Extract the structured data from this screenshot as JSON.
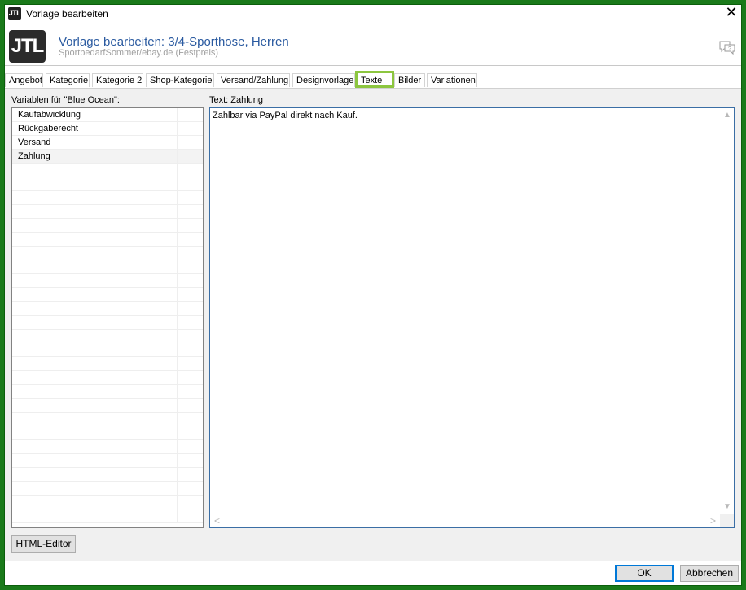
{
  "window": {
    "icon_text": "JTL",
    "title": "Vorlage bearbeiten",
    "close_glyph": "✕"
  },
  "header": {
    "logo_text": "JTL",
    "heading": "Vorlage bearbeiten: 3/4-Sporthose, Herren",
    "subtitle": "SportbedarfSommer/ebay.de (Festpreis)"
  },
  "tabs": [
    {
      "label": "Angebot"
    },
    {
      "label": "Kategorie"
    },
    {
      "label": "Kategorie 2"
    },
    {
      "label": "Shop-Kategorie"
    },
    {
      "label": "Versand/Zahlung"
    },
    {
      "label": "Designvorlage"
    },
    {
      "label": "Texte",
      "active": true
    },
    {
      "label": "Bilder"
    },
    {
      "label": "Variationen"
    }
  ],
  "variables": {
    "label": "Variablen für \"Blue Ocean\":",
    "items": [
      {
        "label": "Kaufabwicklung"
      },
      {
        "label": "Rückgaberecht"
      },
      {
        "label": "Versand"
      },
      {
        "label": "Zahlung",
        "selected": true
      }
    ]
  },
  "editor": {
    "label": "Text: Zahlung",
    "value": "Zahlbar via PayPal direkt nach Kauf."
  },
  "buttons": {
    "html_editor": "HTML-Editor",
    "ok": "OK",
    "cancel": "Abbrechen"
  },
  "icons": {
    "help": "help-chat-icon",
    "scroll_up": "▲",
    "scroll_down": "▼",
    "scroll_left": "<",
    "scroll_right": ">"
  },
  "colors": {
    "accent_tab": "#8cc63f",
    "heading": "#2a5aa0",
    "window_border": "#1a7a1a"
  }
}
